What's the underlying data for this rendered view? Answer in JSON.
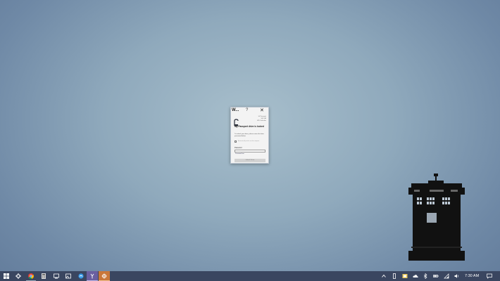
{
  "dialog": {
    "title": "W...",
    "help_label": "?",
    "close_label": "✕",
    "meta_lines": [
      "Hi Passport",
      "500 GB",
      "WD Unlocker"
    ],
    "heading": "My Passport drive is locked",
    "instruction": "To unlock your drive, please enter the drive password below.",
    "remember_label": "Automatically unlock on this computer",
    "password_label": "Password",
    "password_value": "",
    "hint_link": "Password hint",
    "unlock_button": "Unlock Drive"
  },
  "taskbar": {
    "items": [
      {
        "name": "windows-start-icon"
      },
      {
        "name": "settings-icon"
      },
      {
        "name": "chrome-icon"
      },
      {
        "name": "calculator-icon"
      },
      {
        "name": "explorer-icon"
      },
      {
        "name": "edge-icon"
      },
      {
        "name": "app-icon-active",
        "active": true
      },
      {
        "name": "app-icon-orange",
        "active": true
      }
    ],
    "tray": {
      "time": "7:30 AM"
    }
  },
  "colors": {
    "taskbar_bg": "#3a4660",
    "active_task_purple": "#6a5fa0",
    "active_task_orange": "#c9773a",
    "desktop_center": "#a8bfcc",
    "desktop_edge": "#5f7898"
  }
}
